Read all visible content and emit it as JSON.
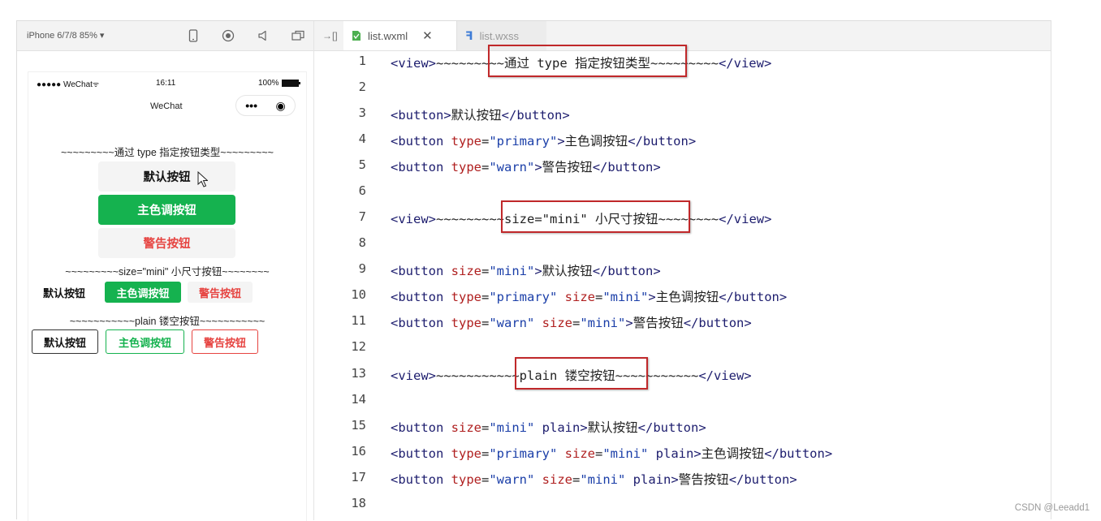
{
  "simulator": {
    "device_select": "iPhone 6/7/8 85% ▾",
    "status_bar": {
      "carrier": "●●●●● WeChat",
      "time": "16:11",
      "battery": "100%"
    },
    "nav_title": "WeChat",
    "capsule": {
      "more": "•••",
      "close": "◉"
    },
    "sep_type": "~~~~~~~~~通过 type 指定按钮类型~~~~~~~~~",
    "sep_size": "~~~~~~~~~size=\"mini\" 小尺寸按钮~~~~~~~~",
    "sep_plain": "~~~~~~~~~~~plain 镂空按钮~~~~~~~~~~~",
    "btn_default": "默认按钮",
    "btn_primary": "主色调按钮",
    "btn_warn": "警告按钮",
    "colors": {
      "primary": "#1aad19",
      "warn": "#e64340",
      "default_bg": "#f4f4f4"
    }
  },
  "editor": {
    "back_icon": "→[]",
    "tabs": [
      {
        "label": "list.wxml",
        "icon": "wxml-file-icon"
      },
      {
        "label": "list.wxss",
        "icon": "wxss-file-icon"
      }
    ],
    "line_numbers": [
      "1",
      "2",
      "3",
      "4",
      "5",
      "6",
      "7",
      "8",
      "9",
      "10",
      "11",
      "12",
      "13",
      "14",
      "15",
      "16",
      "17",
      "18"
    ],
    "code": {
      "l1": {
        "open": "<view>",
        "prefix": "~~~~~~~~",
        "text": "~通过 type 指定按钮类型~",
        "suffix": "~~~~~~~~",
        "close": "</view>"
      },
      "l3": {
        "open": "<button>",
        "text": "默认按钮",
        "close": "</button>"
      },
      "l4": {
        "open": "<button ",
        "attr": "type",
        "eq": "=",
        "val": "\"primary\"",
        "gt": ">",
        "text": "主色调按钮",
        "close": "</button>"
      },
      "l5": {
        "open": "<button ",
        "attr": "type",
        "eq": "=",
        "val": "\"warn\"",
        "gt": ">",
        "text": "警告按钮",
        "close": "</button>"
      },
      "l7": {
        "open": "<view>",
        "prefix": "~~~~~~~~~",
        "text": "size=\"mini\" 小尺寸按钮",
        "suffix": "~~~~~~~~",
        "close": "</view>"
      },
      "l9": {
        "open": "<button ",
        "attr": "size",
        "eq": "=",
        "val": "\"mini\"",
        "gt": ">",
        "text": "默认按钮",
        "close": "</button>"
      },
      "l10": {
        "open": "<button ",
        "attr1": "type",
        "val1": "\"primary\"",
        "attr2": "size",
        "val2": "\"mini\"",
        "gt": ">",
        "text": "主色调按钮",
        "close": "</button>"
      },
      "l11": {
        "open": "<button ",
        "attr1": "type",
        "val1": "\"warn\"",
        "attr2": "size",
        "val2": "\"mini\"",
        "gt": ">",
        "text": "警告按钮",
        "close": "</button>"
      },
      "l13": {
        "open": "<view>",
        "prefix": "~~~~~~~~~~~",
        "text": "plain 镂空按钮~",
        "suffix": "~~~~~~~~~~",
        "close": "</view>"
      },
      "l15": {
        "open": "<button ",
        "attr": "size",
        "val": "\"mini\"",
        "plain": " plain>",
        "text": "默认按钮",
        "close": "</button>"
      },
      "l16": {
        "open": "<button ",
        "attr1": "type",
        "val1": "\"primary\"",
        "attr2": "size",
        "val2": "\"mini\"",
        "plain": " plain>",
        "text": "主色调按钮",
        "close": "</button>"
      },
      "l17": {
        "open": "<button ",
        "attr1": "type",
        "val1": "\"warn\"",
        "attr2": "size",
        "val2": "\"mini\"",
        "plain": " plain>",
        "text": "警告按钮",
        "close": "</button>"
      }
    },
    "highlight_color": "#c0282a"
  },
  "watermark": "CSDN @Leeadd1"
}
